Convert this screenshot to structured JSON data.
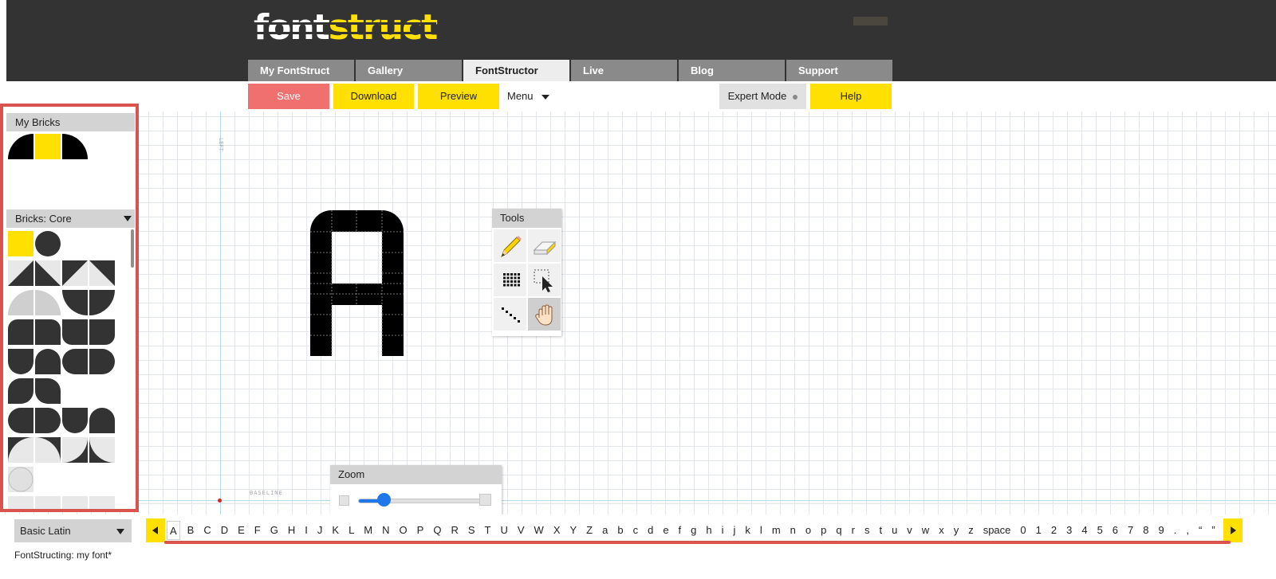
{
  "logo": {
    "part1": "font",
    "part2": "struct",
    "colors": {
      "white": "#ffffff",
      "yellow": "#ffe000"
    }
  },
  "nav": {
    "tabs": [
      {
        "label": "My FontStruct",
        "active": false
      },
      {
        "label": "Gallery",
        "active": false
      },
      {
        "label": "FontStructor",
        "active": true
      },
      {
        "label": "Live",
        "active": false
      },
      {
        "label": "Blog",
        "active": false
      },
      {
        "label": "Support",
        "active": false
      }
    ]
  },
  "toolbar": {
    "save": "Save",
    "download": "Download",
    "preview": "Preview",
    "menu": "Menu",
    "expert": "Expert Mode",
    "help": "Help"
  },
  "canvas": {
    "guide_left_label": "LEFT",
    "guide_baseline_label": "BASELINE",
    "glyph_icon": "letter-a-glyph"
  },
  "tools": {
    "title": "Tools",
    "items": [
      {
        "name": "pencil-tool",
        "icon": "pencil-icon"
      },
      {
        "name": "eraser-tool",
        "icon": "eraser-icon"
      },
      {
        "name": "grid-fill-tool",
        "icon": "grid-icon"
      },
      {
        "name": "select-tool",
        "icon": "select-cursor-icon"
      },
      {
        "name": "line-tool",
        "icon": "dotted-line-icon"
      },
      {
        "name": "hand-tool",
        "icon": "hand-icon",
        "active": true
      }
    ]
  },
  "zoom": {
    "title": "Zoom",
    "level": 0.2
  },
  "my_bricks": {
    "title": "My Bricks"
  },
  "core_bricks": {
    "title": "Bricks: Core"
  },
  "charset": {
    "selected": "Basic Latin",
    "chars": [
      "A",
      "B",
      "C",
      "D",
      "E",
      "F",
      "G",
      "H",
      "I",
      "J",
      "K",
      "L",
      "M",
      "N",
      "O",
      "P",
      "Q",
      "R",
      "S",
      "T",
      "U",
      "V",
      "W",
      "X",
      "Y",
      "Z",
      "a",
      "b",
      "c",
      "d",
      "e",
      "f",
      "g",
      "h",
      "i",
      "j",
      "k",
      "l",
      "m",
      "n",
      "o",
      "p",
      "q",
      "r",
      "s",
      "t",
      "u",
      "v",
      "w",
      "x",
      "y",
      "z",
      "space",
      "0",
      "1",
      "2",
      "3",
      "4",
      "5",
      "6",
      "7",
      "8",
      "9",
      ".",
      ",",
      "“",
      "”"
    ],
    "active_char": "A"
  },
  "status": "FontStructing: my font*",
  "colors": {
    "accent": "#ffe000",
    "save": "#f07070",
    "dark": "#333333",
    "highlight": "#d9534f",
    "zoom_blue": "#1e78ea"
  }
}
